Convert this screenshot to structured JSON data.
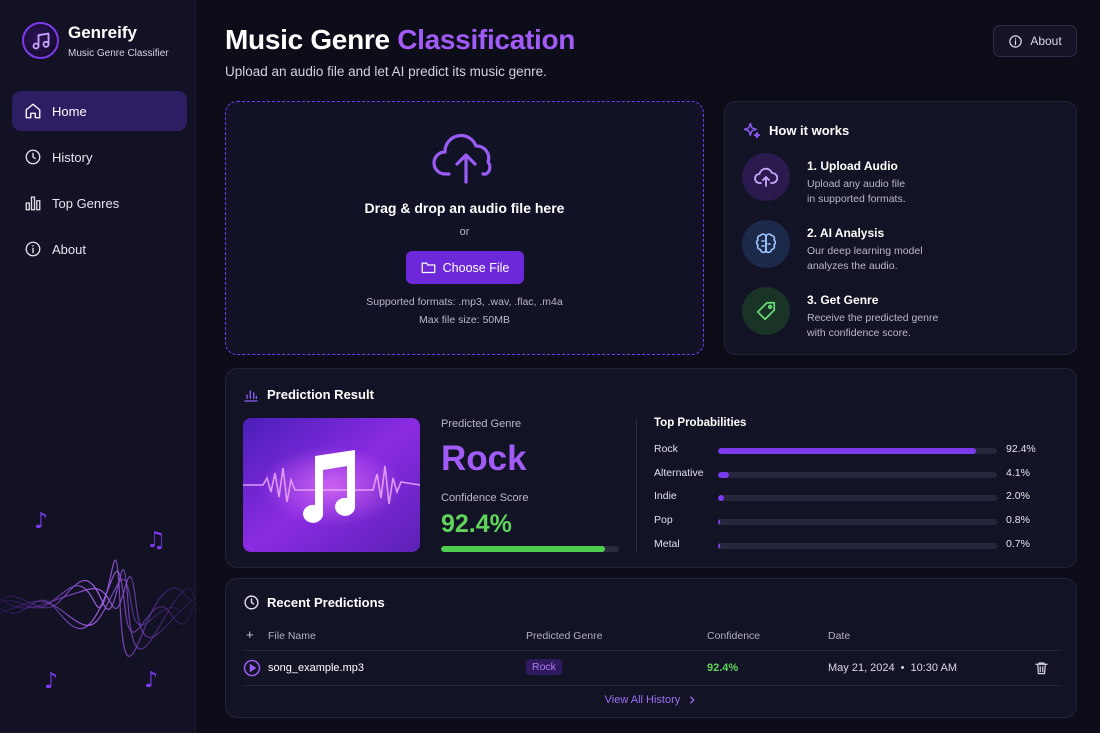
{
  "brand": {
    "name": "Genreify",
    "subtitle": "Music Genre Classifier",
    "logo_icon": "music-note-icon"
  },
  "sidebar": {
    "items": [
      {
        "label": "Home",
        "icon": "home-icon",
        "active": true
      },
      {
        "label": "History",
        "icon": "clock-icon",
        "active": false
      },
      {
        "label": "Top Genres",
        "icon": "bar-chart-icon",
        "active": false
      },
      {
        "label": "About",
        "icon": "info-icon",
        "active": false
      }
    ]
  },
  "header": {
    "title_main": "Music Genre ",
    "title_accent": "Classification",
    "subtitle": "Upload an audio file and let AI predict its music genre.",
    "about_label": "About"
  },
  "upload": {
    "title": "Drag & drop an audio file here",
    "or": "or",
    "button_label": "Choose File",
    "formats": "Supported formats: .mp3, .wav, .flac, .m4a",
    "max_size": "Max file size: 50MB"
  },
  "how_it_works": {
    "title": "How it works",
    "steps": [
      {
        "title": "1. Upload Audio",
        "line1": "Upload any audio file",
        "line2": "in supported formats.",
        "icon": "cloud-upload-icon"
      },
      {
        "title": "2. AI Analysis",
        "line1": "Our deep learning model",
        "line2": "analyzes the audio.",
        "icon": "brain-icon"
      },
      {
        "title": "3. Get Genre",
        "line1": "Receive the predicted genre",
        "line2": "with confidence score.",
        "icon": "tag-icon"
      }
    ]
  },
  "result": {
    "title": "Prediction Result",
    "predicted_label": "Predicted Genre",
    "genre": "Rock",
    "confidence_label": "Confidence Score",
    "confidence": "92.4%",
    "confidence_fraction": 0.924,
    "probabilities_title": "Top Probabilities",
    "probabilities": [
      {
        "name": "Rock",
        "value": "92.4%",
        "fraction": 0.924
      },
      {
        "name": "Alternative",
        "value": "4.1%",
        "fraction": 0.041
      },
      {
        "name": "Indie",
        "value": "2.0%",
        "fraction": 0.02
      },
      {
        "name": "Pop",
        "value": "0.8%",
        "fraction": 0.008
      },
      {
        "name": "Metal",
        "value": "0.7%",
        "fraction": 0.007
      }
    ]
  },
  "recent": {
    "title": "Recent Predictions",
    "columns": [
      "File Name",
      "Predicted Genre",
      "Confidence",
      "Date"
    ],
    "rows": [
      {
        "file": "song_example.mp3",
        "genre": "Rock",
        "confidence": "92.4%",
        "date": "May 21, 2024",
        "time": "10:30 AM"
      }
    ],
    "view_all": "View All History"
  },
  "colors": {
    "accent": "#a15bf7",
    "primary_button": "#6d28d9",
    "success": "#5fd35a",
    "background": "#0d0d1a"
  }
}
